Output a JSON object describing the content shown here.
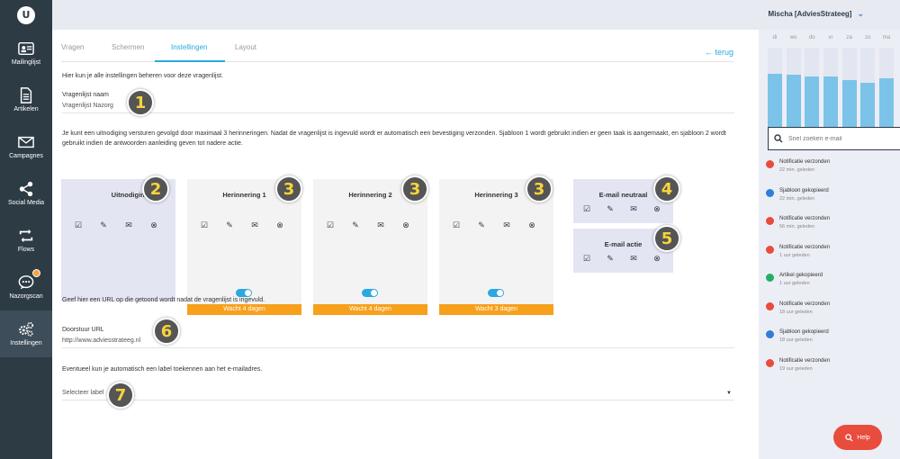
{
  "app": {
    "logo_letter": "U"
  },
  "header": {
    "user": "Mischa [AdviesStrateeg]"
  },
  "sidebar": {
    "items": [
      {
        "label": "Mailinglijst",
        "icon": "contact-card-icon"
      },
      {
        "label": "Artikelen",
        "icon": "document-icon"
      },
      {
        "label": "Campagnes",
        "icon": "envelope-icon"
      },
      {
        "label": "Social Media",
        "icon": "share-icon"
      },
      {
        "label": "Flows",
        "icon": "flows-icon"
      },
      {
        "label": "Nazorgscan",
        "icon": "chat-bubble-icon"
      },
      {
        "label": "Instellingen",
        "icon": "gears-icon"
      }
    ]
  },
  "tabs": [
    "Vragen",
    "Schermen",
    "Instellingen",
    "Layout"
  ],
  "active_tab": "Instellingen",
  "back_label": "← terug",
  "intro": "Hier kun je alle instellingen beheren voor deze vragenlijst.",
  "name_field": {
    "label": "Vragenlijst naam",
    "value": "Vragenlijst Nazorg"
  },
  "description": "Je kunt een uitnodiging versturen gevolgd door maximaal 3 herinneringen. Nadat de vragenlijst is ingevuld wordt er automatisch een bevestiging verzonden. Sjabloon 1 wordt gebruikt indien er geen taak is aangemaakt, en sjabloon 2 wordt gebruikt indien de antwoorden aanleiding geven tot nadere actie.",
  "cards": [
    {
      "title": "Uitnodiging",
      "marker": "2"
    },
    {
      "title": "Herinnering 1",
      "marker": "3",
      "wait": "Wacht 4 dagen"
    },
    {
      "title": "Herinnering 2",
      "marker": "3",
      "wait": "Wacht 4 dagen"
    },
    {
      "title": "Herinnering 3",
      "marker": "3",
      "wait": "Wacht 3 dagen"
    },
    {
      "title": "E-mail neutraal",
      "marker": "4"
    },
    {
      "title": "E-mail actie",
      "marker": "5"
    }
  ],
  "marker_1": "1",
  "url_intro": "Geef hier een URL op die getoond wordt nadat de vragenlijst is ingevuld.",
  "url_field": {
    "label": "Doorstuur URL",
    "value": "http://www.adviesstrateeg.nl",
    "marker": "6"
  },
  "label_intro": "Eventueel kun je automatisch een label toekennen aan het e-mailadres.",
  "label_select": {
    "placeholder": "Selecteer label",
    "marker": "7"
  },
  "right": {
    "days": [
      "di",
      "wo",
      "do",
      "vr",
      "za",
      "zo",
      "ma"
    ],
    "bar_values": [
      0.67,
      0.66,
      0.64,
      0.64,
      0.59,
      0.56,
      0.61
    ],
    "search_placeholder": "Snel zoeken e-mail",
    "feed": [
      {
        "title": "Notificatie verzonden",
        "time": "22 min. geleden",
        "color": "#e84c3d"
      },
      {
        "title": "Sjabloon gekopieerd",
        "time": "22 min. geleden",
        "color": "#2f7fd6"
      },
      {
        "title": "Notificatie verzonden",
        "time": "56 min. geleden",
        "color": "#e84c3d"
      },
      {
        "title": "Notificatie verzonden",
        "time": "1 uur geleden",
        "color": "#e84c3d"
      },
      {
        "title": "Artikel gekopieerd",
        "time": "1 uur geleden",
        "color": "#27ae60"
      },
      {
        "title": "Notificatie verzonden",
        "time": "18 uur geleden",
        "color": "#e84c3d"
      },
      {
        "title": "Sjabloon gekopieerd",
        "time": "18 uur geleden",
        "color": "#2f7fd6"
      },
      {
        "title": "Notificatie verzonden",
        "time": "19 uur geleden",
        "color": "#e84c3d"
      }
    ]
  },
  "help_label": "Help",
  "colors": {
    "accent": "#2aa8e0",
    "sidebar": "#2d3b45",
    "wait": "#f7a01c",
    "help": "#e84c3d"
  }
}
